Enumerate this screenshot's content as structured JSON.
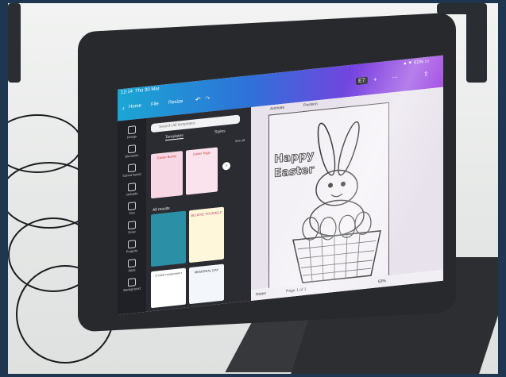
{
  "status": {
    "time": "12:14",
    "date": "Thu 30 Mar",
    "battery": "● ▼ 61% ▭"
  },
  "topbar": {
    "home": "Home",
    "file": "File",
    "resize": "Resize",
    "undo_icon": "↶",
    "redo_icon": "↷",
    "avatar": "E7",
    "plus": "+",
    "more": "⋯",
    "share_icon": "⇪"
  },
  "sidebar": {
    "items": [
      {
        "label": "Design"
      },
      {
        "label": "Elements"
      },
      {
        "label": "Canva Assist"
      },
      {
        "label": "Uploads"
      },
      {
        "label": "Text"
      },
      {
        "label": "Draw"
      },
      {
        "label": "Projects"
      },
      {
        "label": "Apps"
      },
      {
        "label": "Background"
      }
    ]
  },
  "panel": {
    "search_placeholder": "Search All templates",
    "tab_templates": "Templates",
    "tab_styles": "Styles",
    "see_all": "See all",
    "section_all_results": "All results",
    "arrow": "›",
    "thumbnails": [
      {
        "title": "Easter Bunny",
        "color": "#f7d7e3"
      },
      {
        "title": "Easter Eggs",
        "color": "#fbe3ee"
      },
      {
        "title": "BELIEVE YOURSELF",
        "color": "#fff7d9"
      },
      {
        "title": "MEMORIAL DAY",
        "color": "#f3f6fb"
      },
      {
        "title": "STUDENT WORKSHEET",
        "color": "#fff"
      }
    ]
  },
  "canvas": {
    "toolbar_animate": "Animate",
    "toolbar_position": "Position",
    "title_line1": "Happy",
    "title_line2": "Easter",
    "page_label": "Page 1 of 1",
    "notes": "Notes",
    "zoom": "63%"
  }
}
